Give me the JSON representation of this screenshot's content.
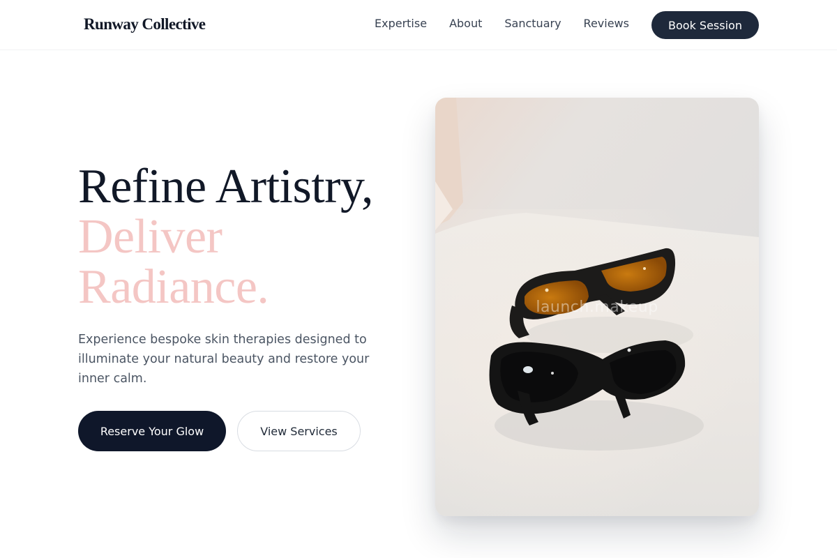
{
  "brand": {
    "name": "Runway Collective"
  },
  "nav": {
    "links": [
      "Expertise",
      "About",
      "Sanctuary",
      "Reviews"
    ],
    "cta": "Book Session"
  },
  "hero": {
    "headline_line1": "Refine Artistry,",
    "headline_line2": "Deliver",
    "headline_line3": "Radiance.",
    "subtext": "Experience bespoke skin therapies designed to illuminate your natural beauty and restore your inner calm.",
    "primary_button": "Reserve Your Glow",
    "secondary_button": "View Services",
    "image_watermark": "launch.makeup",
    "image_alt": "Two pairs of protective sunglasses on a white surface"
  },
  "colors": {
    "navy": "#0f172a",
    "pink_accent": "#f4c6c4",
    "body_text": "#4b5563"
  },
  "icons": []
}
